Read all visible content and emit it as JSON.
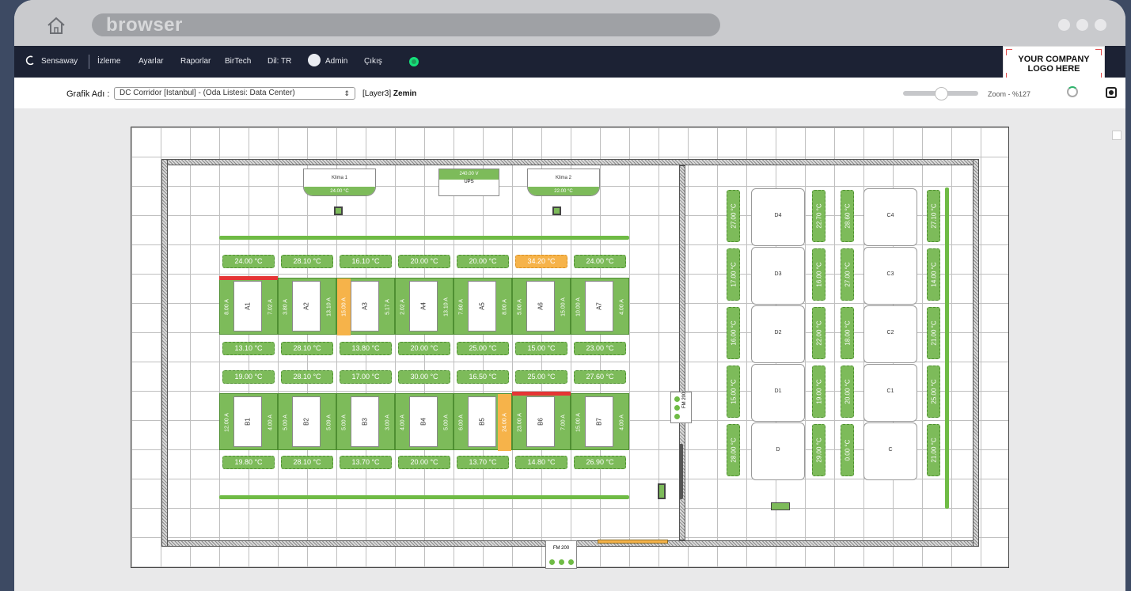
{
  "browser": {
    "url_text": "browser"
  },
  "nav": {
    "brand": "Sensaway",
    "items": [
      "İzleme",
      "Ayarlar",
      "Raporlar",
      "BirTech",
      "Dil: TR"
    ],
    "user": "Admin",
    "logout": "Çıkış"
  },
  "logo": {
    "line1": "YOUR COMPANY",
    "line2": "LOGO HERE"
  },
  "toolbar": {
    "label": "Grafik Adı :",
    "selected": "DC Corridor [Istanbul] - (Oda Listesi: Data Center)",
    "layer_prefix": "[Layer3]",
    "layer_name": "Zemin",
    "zoom": "Zoom - %127",
    "zoom_level": 0.5
  },
  "plan": {
    "acs": [
      {
        "name": "Klima 1",
        "temp": "24.00 °C"
      },
      {
        "name": "Klima 2",
        "temp": "22.00 °C"
      }
    ],
    "ups": {
      "voltage": "240.00 V",
      "name": "UPS"
    },
    "row_a_top": [
      "24.00 °C",
      "28.10 °C",
      "16.10 °C",
      "20.00 °C",
      "20.00 °C",
      "34.20 °C",
      "24.00 °C"
    ],
    "row_a_bottom": [
      "13.10 °C",
      "28.10 °C",
      "13.80 °C",
      "20.00 °C",
      "25.00 °C",
      "15.00 °C",
      "23.00 °C"
    ],
    "row_b_top": [
      "19.00 °C",
      "28.10 °C",
      "17.00 °C",
      "30.00 °C",
      "16.50 °C",
      "25.00 °C",
      "27.60 °C"
    ],
    "row_b_bottom": [
      "19.80 °C",
      "28.10 °C",
      "13.70 °C",
      "20.00 °C",
      "13.70 °C",
      "14.80 °C",
      "26.90 °C"
    ],
    "racks_a": [
      {
        "label": "A1",
        "left": "8.00 A",
        "right": "7.02 A"
      },
      {
        "label": "A2",
        "left": "3.80 A",
        "right": "13.10 A"
      },
      {
        "label": "A3",
        "left": "15.00 A",
        "right": "5.17 A"
      },
      {
        "label": "A4",
        "left": "2.02 A",
        "right": "13.10 A"
      },
      {
        "label": "A5",
        "left": "7.60 A",
        "right": "8.00 A"
      },
      {
        "label": "A6",
        "left": "5.00 A",
        "right": "15.00 A"
      },
      {
        "label": "A7",
        "left": "10.00 A",
        "right": "4.00 A"
      }
    ],
    "racks_b": [
      {
        "label": "B1",
        "left": "12.00 A",
        "right": "4.00 A"
      },
      {
        "label": "B2",
        "left": "5.00 A",
        "right": "5.09 A"
      },
      {
        "label": "B3",
        "left": "5.00 A",
        "right": "3.00 A"
      },
      {
        "label": "B4",
        "left": "4.00 A",
        "right": "5.00 A"
      },
      {
        "label": "B5",
        "left": "6.00 A",
        "right": "24.00 A"
      },
      {
        "label": "B6",
        "left": "23.00 A",
        "right": "7.00 A"
      },
      {
        "label": "B7",
        "left": "15.00 A",
        "right": "4.00 A"
      }
    ],
    "d_racks": [
      "D4",
      "D3",
      "D2",
      "D1",
      "D"
    ],
    "c_racks": [
      "C4",
      "C3",
      "C2",
      "C1",
      "C"
    ],
    "d_left_temps": [
      "27.00 °C",
      "17.00 °C",
      "16.00 °C",
      "15.00 °C",
      "28.00 °C"
    ],
    "d_right_temps": [
      "22.70 °C",
      "16.00 °C",
      "22.00 °C",
      "19.00 °C",
      "29.00 °C"
    ],
    "c_left_temps": [
      "28.60 °C",
      "27.00 °C",
      "18.00 °C",
      "20.00 °C",
      "0.00 °C"
    ],
    "c_right_temps": [
      "27.10 °C",
      "14.00 °C",
      "21.00 °C",
      "25.00 °C",
      "21.00 °C"
    ],
    "fm_label": "FM 200"
  },
  "colors": {
    "green": "#7dbb5a",
    "warning": "#f6b34a",
    "alarm": "#e53535",
    "navbar": "#1c2234"
  }
}
